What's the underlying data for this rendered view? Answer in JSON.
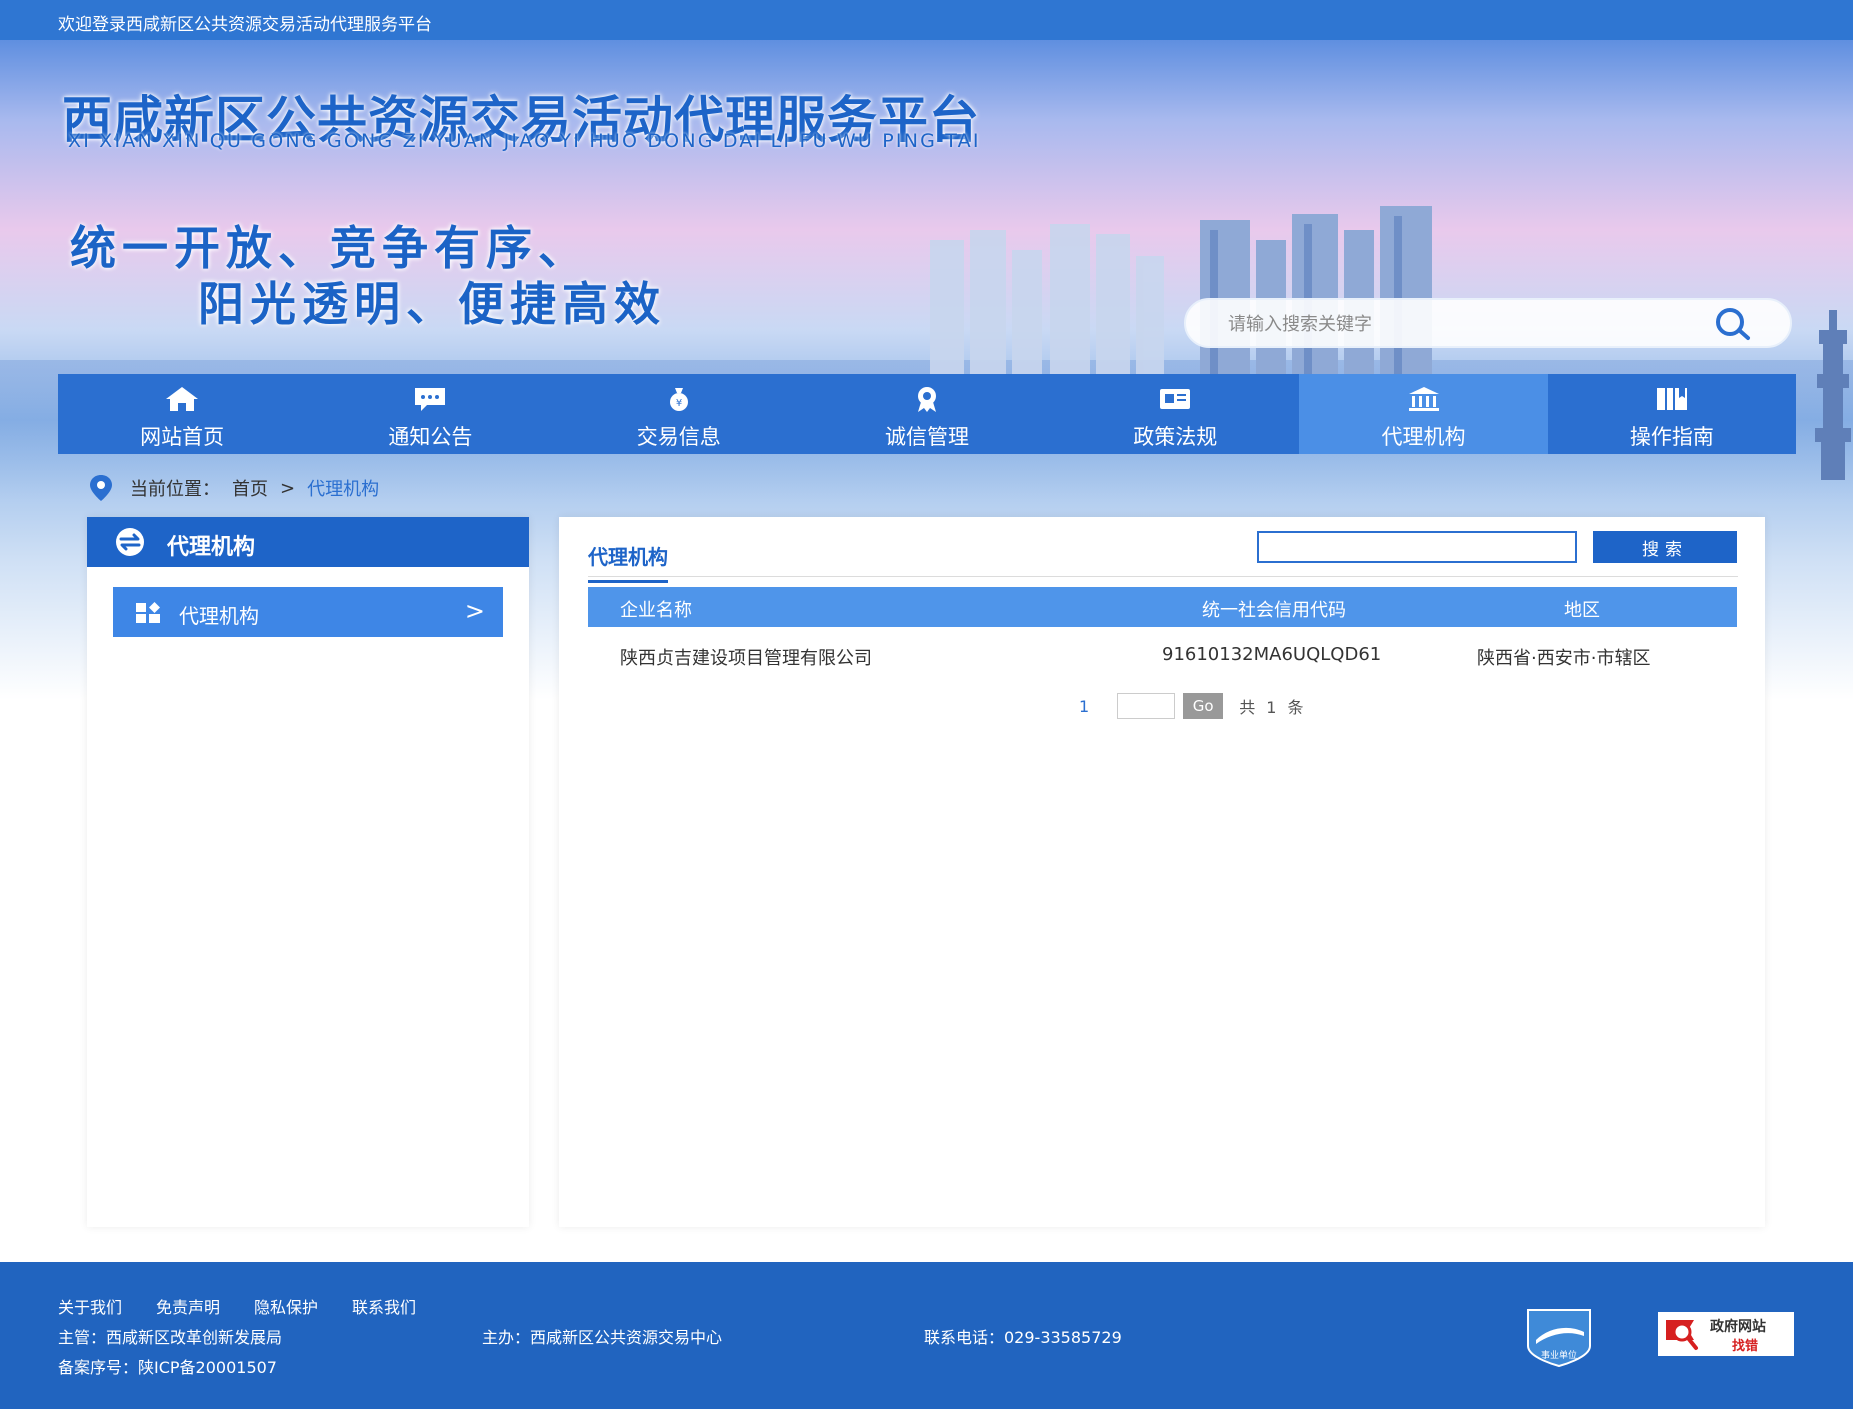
{
  "top_bar": {
    "welcome": "欢迎登录西咸新区公共资源交易活动代理服务平台"
  },
  "header": {
    "title": "西咸新区公共资源交易活动代理服务平台",
    "subtitle": "XI XIAN XIN QU GONG GONG ZI YUAN JIAO YI HUO DONG DAI LI FU WU PING TAI",
    "slogan_line1": "统一开放、竞争有序、",
    "slogan_line2": "阳光透明、便捷高效",
    "search_placeholder": "请输入搜索关键字"
  },
  "nav": {
    "items": [
      {
        "label": "网站首页",
        "icon": "home-icon"
      },
      {
        "label": "通知公告",
        "icon": "chat-icon"
      },
      {
        "label": "交易信息",
        "icon": "money-bag-icon"
      },
      {
        "label": "诚信管理",
        "icon": "award-icon"
      },
      {
        "label": "政策法规",
        "icon": "document-icon"
      },
      {
        "label": "代理机构",
        "icon": "institution-icon",
        "active": true
      },
      {
        "label": "操作指南",
        "icon": "book-icon"
      }
    ]
  },
  "breadcrumb": {
    "prefix": "当前位置：",
    "home": "首页",
    "separator": ">",
    "current": "代理机构"
  },
  "sidebar": {
    "title": "代理机构",
    "items": [
      {
        "label": "代理机构",
        "arrow": ">"
      }
    ]
  },
  "main": {
    "tab": "代理机构",
    "search_value": "",
    "search_button": "搜索",
    "table": {
      "headers": [
        "企业名称",
        "统一社会信用代码",
        "地区"
      ],
      "rows": [
        [
          "陕西贞吉建设项目管理有限公司",
          "91610132MA6UQLQD61",
          "陕西省·西安市·市辖区"
        ]
      ]
    },
    "pager": {
      "page": "1",
      "go": "Go",
      "total": "共 1 条"
    }
  },
  "footer": {
    "links": [
      "关于我们",
      "免责声明",
      "隐私保护",
      "联系我们"
    ],
    "supervisor": "主管：西咸新区改革创新发展局",
    "host": "主办：西咸新区公共资源交易中心",
    "phone": "联系电话：029-33585729",
    "icp": "备案序号：陕ICP备20001507",
    "badge1_text": "事业单位",
    "badge2_line1": "政府网站",
    "badge2_line2": "找错"
  },
  "colors": {
    "primary": "#1e64c8",
    "nav": "#2b6fd0",
    "nav_active": "#4b8fe6",
    "table_head": "#4f95ea",
    "footer": "#2164bf"
  }
}
